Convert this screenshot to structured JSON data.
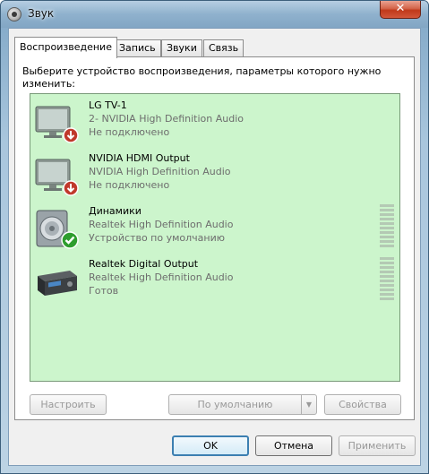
{
  "window": {
    "title": "Звук",
    "close_label": "✕"
  },
  "tabs": [
    {
      "label": "Воспроизведение",
      "active": true
    },
    {
      "label": "Запись",
      "active": false
    },
    {
      "label": "Звуки",
      "active": false
    },
    {
      "label": "Связь",
      "active": false
    }
  ],
  "instruction": "Выберите устройство воспроизведения, параметры которого нужно изменить:",
  "devices": [
    {
      "name": "LG TV-1",
      "description": "2- NVIDIA High Definition Audio",
      "status": "Не подключено",
      "icon": "monitor-icon",
      "badge": "disconnected-badge-icon",
      "has_meter": false
    },
    {
      "name": "NVIDIA HDMI Output",
      "description": "NVIDIA High Definition Audio",
      "status": "Не подключено",
      "icon": "monitor-icon",
      "badge": "disconnected-badge-icon",
      "has_meter": false
    },
    {
      "name": "Динамики",
      "description": "Realtek High Definition Audio",
      "status": "Устройство по умолчанию",
      "icon": "speaker-icon",
      "badge": "default-check-icon",
      "has_meter": true
    },
    {
      "name": "Realtek Digital Output",
      "description": "Realtek High Definition Audio",
      "status": "Готов",
      "icon": "receiver-icon",
      "badge": "",
      "has_meter": true
    }
  ],
  "buttons": {
    "configure": "Настроить",
    "set_default": "По умолчанию",
    "set_default_arrow": "▼",
    "properties": "Свойства",
    "ok": "OK",
    "cancel": "Отмена",
    "apply": "Применить"
  },
  "colors": {
    "list_background": "#ccf5cc",
    "accent": "#3c7fb1",
    "error_badge": "#c0392b",
    "check_badge": "#2e9d2e"
  }
}
